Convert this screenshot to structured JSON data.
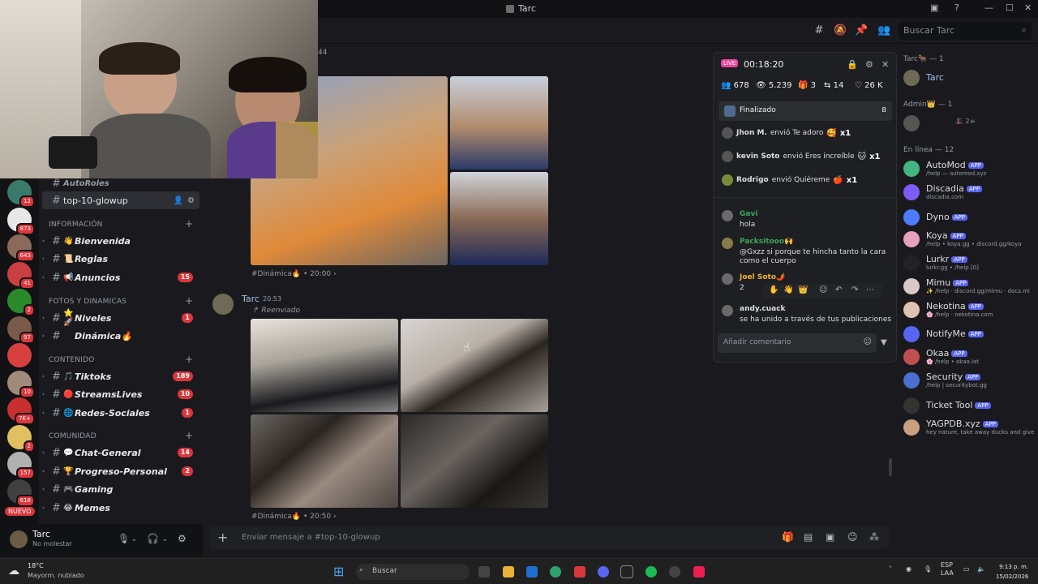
{
  "window": {
    "title": "Tarc"
  },
  "search": {
    "placeholder": "Buscar Tarc"
  },
  "sidebar": {
    "top_partial": "AutoRoles",
    "selected_channel": "top-10-glowup",
    "categories": [
      {
        "label": "INFORMACIÓN",
        "channels": [
          {
            "emoji": "👋",
            "label": "Bienvenida",
            "count": ""
          },
          {
            "emoji": "📜",
            "label": "Reglas",
            "count": ""
          },
          {
            "emoji": "📢",
            "label": "Anuncios",
            "count": "15"
          }
        ]
      },
      {
        "label": "FOTOS Y DINAMICAS",
        "channels": [
          {
            "emoji": "⭐🚀",
            "label": "Niveles",
            "count": "1"
          },
          {
            "emoji": "",
            "label": "Dinámica🔥",
            "count": ""
          }
        ]
      },
      {
        "label": "CONTENIDO",
        "channels": [
          {
            "emoji": "🎵",
            "label": "Tiktoks",
            "count": "189"
          },
          {
            "emoji": "🔴",
            "label": "StreamsLives",
            "count": "10"
          },
          {
            "emoji": "🌐",
            "label": "Redes-Sociales",
            "count": "1"
          }
        ]
      },
      {
        "label": "COMUNIDAD",
        "channels": [
          {
            "emoji": "💬",
            "label": "Chat-General",
            "count": "14"
          },
          {
            "emoji": "🏆",
            "label": "Progreso-Personal",
            "count": "2"
          },
          {
            "emoji": "🎮",
            "label": "Gaming",
            "count": ""
          },
          {
            "emoji": "😂",
            "label": "Memes",
            "count": ""
          }
        ]
      }
    ],
    "servers": [
      {
        "badge": "12"
      },
      {
        "badge": "873"
      },
      {
        "badge": "643"
      },
      {
        "badge": "41"
      },
      {
        "badge": "2"
      },
      {
        "badge": "97"
      },
      {
        "badge": ""
      },
      {
        "badge": "10"
      },
      {
        "badge": "7K+"
      },
      {
        "badge": "2"
      },
      {
        "badge": "157"
      },
      {
        "badge": "618"
      }
    ],
    "new_label": "NUEVO"
  },
  "user": {
    "name": "Tarc",
    "status": "No molestar"
  },
  "chat": {
    "partial_ts": "44",
    "first_ts": "#Dinámica🔥 • 20:00",
    "author": "Tarc",
    "time": "20:53",
    "forwarded": "Reenviado",
    "second_ts": "#Dinámica🔥 • 20:50",
    "composer_placeholder": "Enviar mensaje a #top-10-glowup"
  },
  "live": {
    "badge": "LIVE",
    "timer": "00:18:20",
    "stats": [
      "678",
      "5.239",
      "3",
      "14",
      "26 K"
    ],
    "finalizado": "Finalizado",
    "finalizado_tag": "B",
    "gifts": [
      {
        "user": "Jhon M.",
        "text": "envió Te adoro",
        "gift": "🥰",
        "x": "x1"
      },
      {
        "user": "kevin Soto",
        "text": "envió Eres increíble",
        "gift": "🐱",
        "x": "x1"
      },
      {
        "user": "Rodrigo",
        "text": "envió Quiéreme",
        "gift": "🍎",
        "x": "x1"
      }
    ],
    "comments": [
      {
        "name": "Gavi",
        "text": "hola",
        "color": "#3ba55d"
      },
      {
        "name": "Packsitooo🙌",
        "text": "@Gxzz si porque te hincha tanto la cara como el cuerpo",
        "color": "#3ba55d"
      },
      {
        "name": "Joel Soto🌶️",
        "text": "2",
        "color": "#f0b232"
      },
      {
        "name": "andy.cuack",
        "text": "se ha unido a través de tus publicaciones",
        "color": "#dbdee1"
      }
    ],
    "comment_placeholder": "Añadir comentario"
  },
  "members": {
    "categories": [
      {
        "label": "Tarc🐂 — 1"
      },
      {
        "label": "Admin👑 — 1"
      },
      {
        "label": "En línea — 12"
      }
    ],
    "owner": "Tarc",
    "admin_tag": "🎩 2☠",
    "app_label": "APP",
    "list": [
      {
        "name": "AutoMod",
        "sub": "/help — automod.xyz",
        "color": "#43b581"
      },
      {
        "name": "Discadia",
        "sub": "discadia.com",
        "color": "#7b5cf5"
      },
      {
        "name": "Dyno",
        "sub": "",
        "color": "#4f7cff"
      },
      {
        "name": "Koya",
        "sub": "/help • koya.gg • discord.gg/koya",
        "color": "#e8a0c0"
      },
      {
        "name": "Lurkr",
        "sub": "lurkr.gg • /help [0]",
        "color": "#222"
      },
      {
        "name": "Mimu",
        "sub": "✨ /help · discord.gg/mimu · docs.mi",
        "color": "#d8c8c8"
      },
      {
        "name": "Nekotina",
        "sub": "🌸 /help · nekotina.com",
        "color": "#e0c2b0"
      },
      {
        "name": "NotifyMe",
        "sub": "",
        "color": "#5865f2"
      },
      {
        "name": "Okaa",
        "sub": "🌸 /help • okaa.lat",
        "color": "#c05050"
      },
      {
        "name": "Security",
        "sub": "/help | securitybot.gg",
        "color": "#4a6fd0"
      },
      {
        "name": "Ticket Tool",
        "sub": "",
        "color": "#333"
      },
      {
        "name": "YAGPDB.xyz",
        "sub": "hey nature, take away ducks and give",
        "color": "#c8a080"
      }
    ]
  },
  "taskbar": {
    "temp": "18°C",
    "weather": "Mayorm. nublado",
    "search": "Buscar",
    "lang1": "ESP",
    "lang2": "LAA",
    "time": "9:13 p. m.",
    "date": "15/02/2026"
  }
}
